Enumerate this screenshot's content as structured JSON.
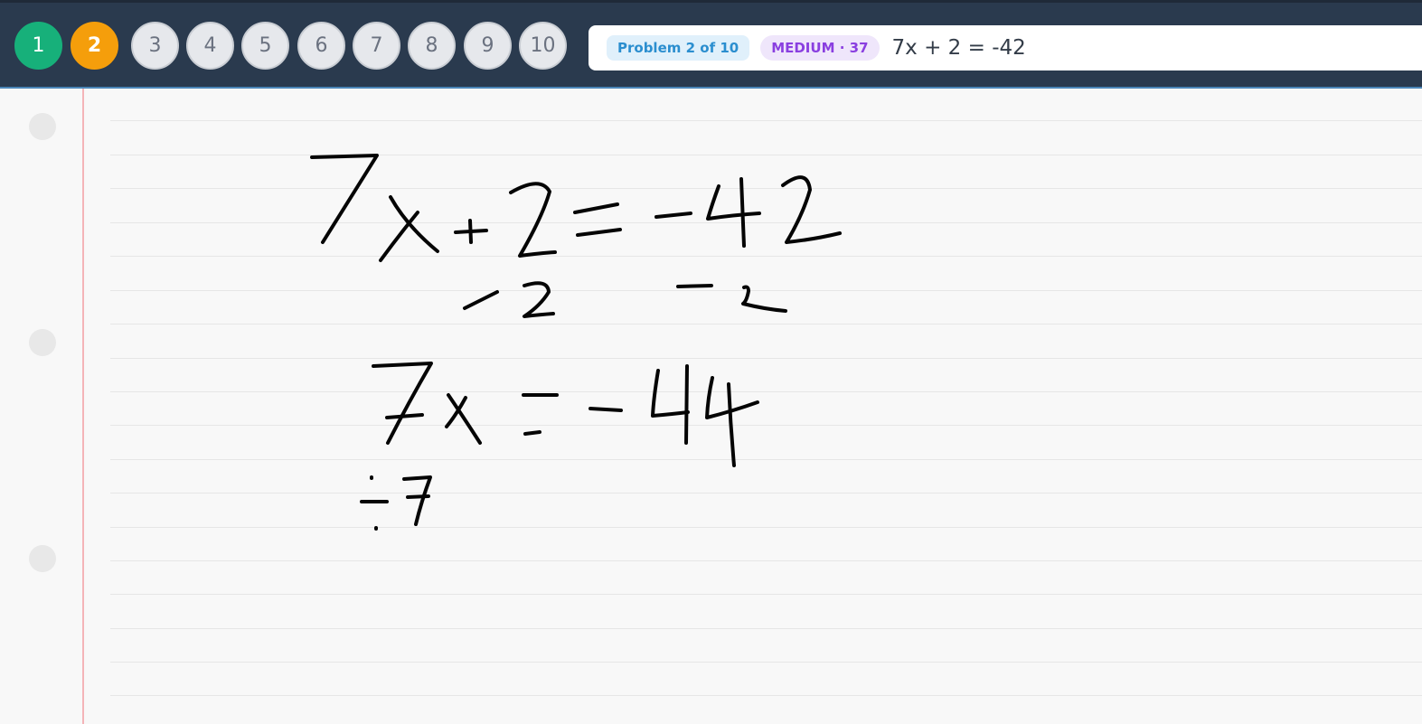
{
  "nav": {
    "problems": [
      {
        "label": "1",
        "state": "done"
      },
      {
        "label": "2",
        "state": "current"
      },
      {
        "label": "3",
        "state": "pending"
      },
      {
        "label": "4",
        "state": "pending"
      },
      {
        "label": "5",
        "state": "pending"
      },
      {
        "label": "6",
        "state": "pending"
      },
      {
        "label": "7",
        "state": "pending"
      },
      {
        "label": "8",
        "state": "pending"
      },
      {
        "label": "9",
        "state": "pending"
      },
      {
        "label": "10",
        "state": "pending"
      }
    ]
  },
  "problem": {
    "progress_label": "Problem 2 of 10",
    "level_label": "MEDIUM · 37",
    "equation": "7x + 2 = -42"
  },
  "colors": {
    "topbar": "#2a3a4e",
    "done": "#17b07a",
    "current": "#f59e0b",
    "pending": "#e6e8ec",
    "margin": "#f4b4b8",
    "ink": "#050505"
  }
}
